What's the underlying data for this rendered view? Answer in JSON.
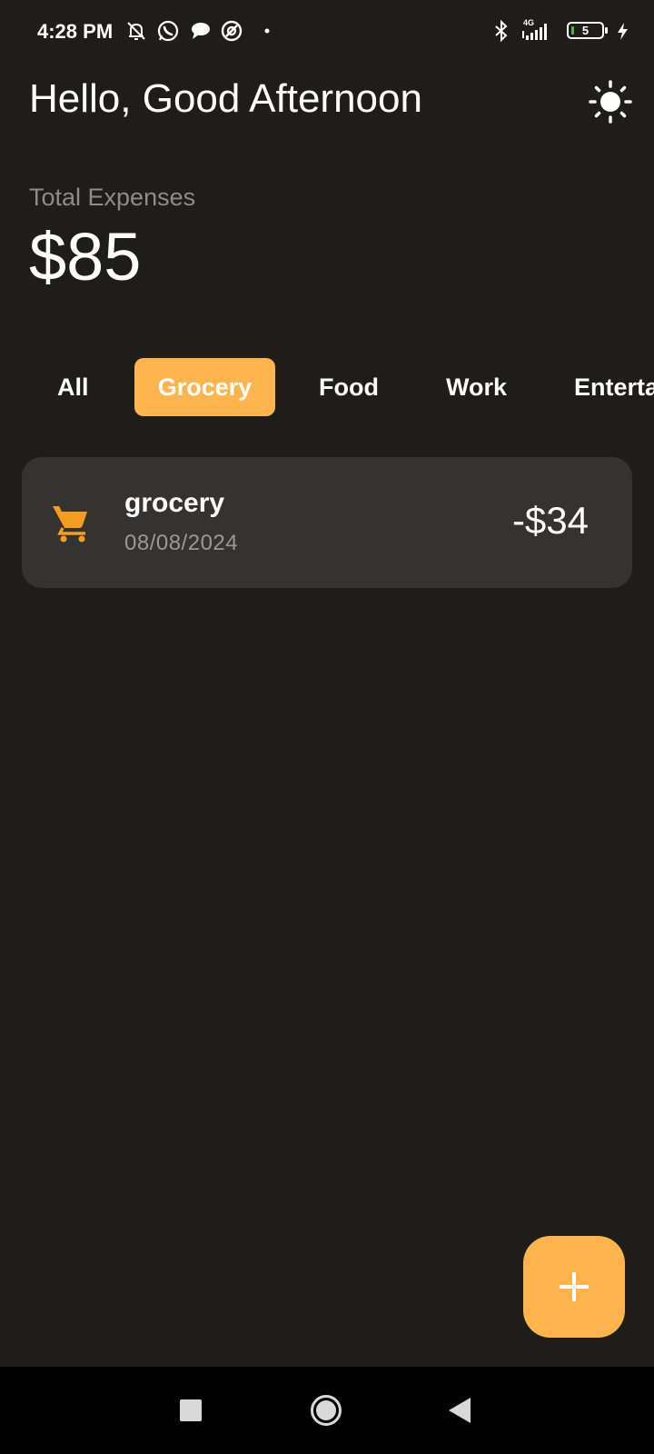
{
  "status_bar": {
    "time": "4:28 PM",
    "battery_level": "5",
    "network_type": "4G",
    "icons": [
      "notifications-off-icon",
      "whatsapp-icon",
      "chat-icon",
      "app-icon",
      "dot-icon",
      "bluetooth-icon",
      "signal-icon",
      "battery-icon",
      "charging-icon"
    ]
  },
  "header": {
    "greeting": "Hello, Good Afternoon",
    "theme_icon": "sun-icon"
  },
  "summary": {
    "label": "Total Expenses",
    "value": "$85"
  },
  "filters": {
    "tabs": [
      {
        "label": "All",
        "active": false
      },
      {
        "label": "Grocery",
        "active": true
      },
      {
        "label": "Food",
        "active": false
      },
      {
        "label": "Work",
        "active": false
      },
      {
        "label": "Enterta",
        "active": false
      }
    ]
  },
  "transactions": [
    {
      "icon": "cart-icon",
      "title": "grocery",
      "date": "08/08/2024",
      "amount": "-$34"
    }
  ],
  "fab": {
    "icon": "plus-icon"
  },
  "nav": {
    "icons": [
      "recents-icon",
      "home-icon",
      "back-icon"
    ]
  },
  "colors": {
    "background": "#1e1d1a",
    "accent": "#ffb54d",
    "card": "#343332",
    "cart_icon": "#f59d1c",
    "battery_fill": "#4caf50"
  }
}
